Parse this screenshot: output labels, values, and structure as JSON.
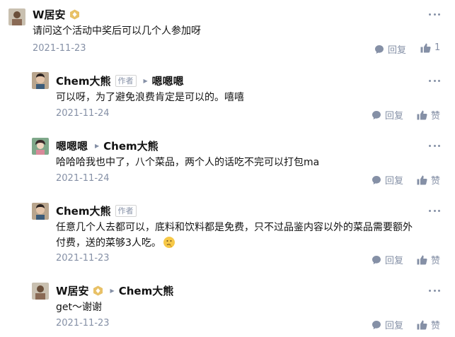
{
  "comments": [
    {
      "author": "W居安",
      "text": "请问这个活动中奖后可以几个人参加呀",
      "time": "2021-11-23",
      "reply_label": "回复",
      "like_label": "1"
    },
    {
      "author": "Chem大熊",
      "tag": "作者",
      "reply_to": "嗯嗯嗯",
      "text": "可以呀，为了避免浪费肯定是可以的。嘻嘻",
      "time": "2021-11-24",
      "reply_label": "回复",
      "like_label": "赞"
    },
    {
      "author": "嗯嗯嗯",
      "reply_to": "Chem大熊",
      "text": "哈哈哈我也中了，八个菜品，两个人的话吃不完可以打包ma",
      "time": "2021-11-24",
      "reply_label": "回复",
      "like_label": "赞"
    },
    {
      "author": "Chem大熊",
      "tag": "作者",
      "text_line1": "任意几个人去都可以，底料和饮料都是免费，只不过品鉴内容以外的菜品需要额外",
      "text_line2": "付费，送的菜够3人吃。",
      "time": "2021-11-23",
      "reply_label": "回复",
      "like_label": "赞"
    },
    {
      "author": "W居安",
      "reply_to": "Chem大熊",
      "text": "get～谢谢",
      "time": "2021-11-23",
      "reply_label": "回复",
      "like_label": "赞"
    }
  ],
  "icons": {
    "reply": "speech-bubble-icon",
    "like": "thumbs-up-icon",
    "more": "more-dots-icon",
    "badge": "hexagon-badge-icon",
    "reply_arrow": "triangle-right-icon",
    "emoji": "thinking-face-icon"
  },
  "colors": {
    "meta": "#8590a6",
    "text": "#121212",
    "badge": "#e8c167"
  }
}
